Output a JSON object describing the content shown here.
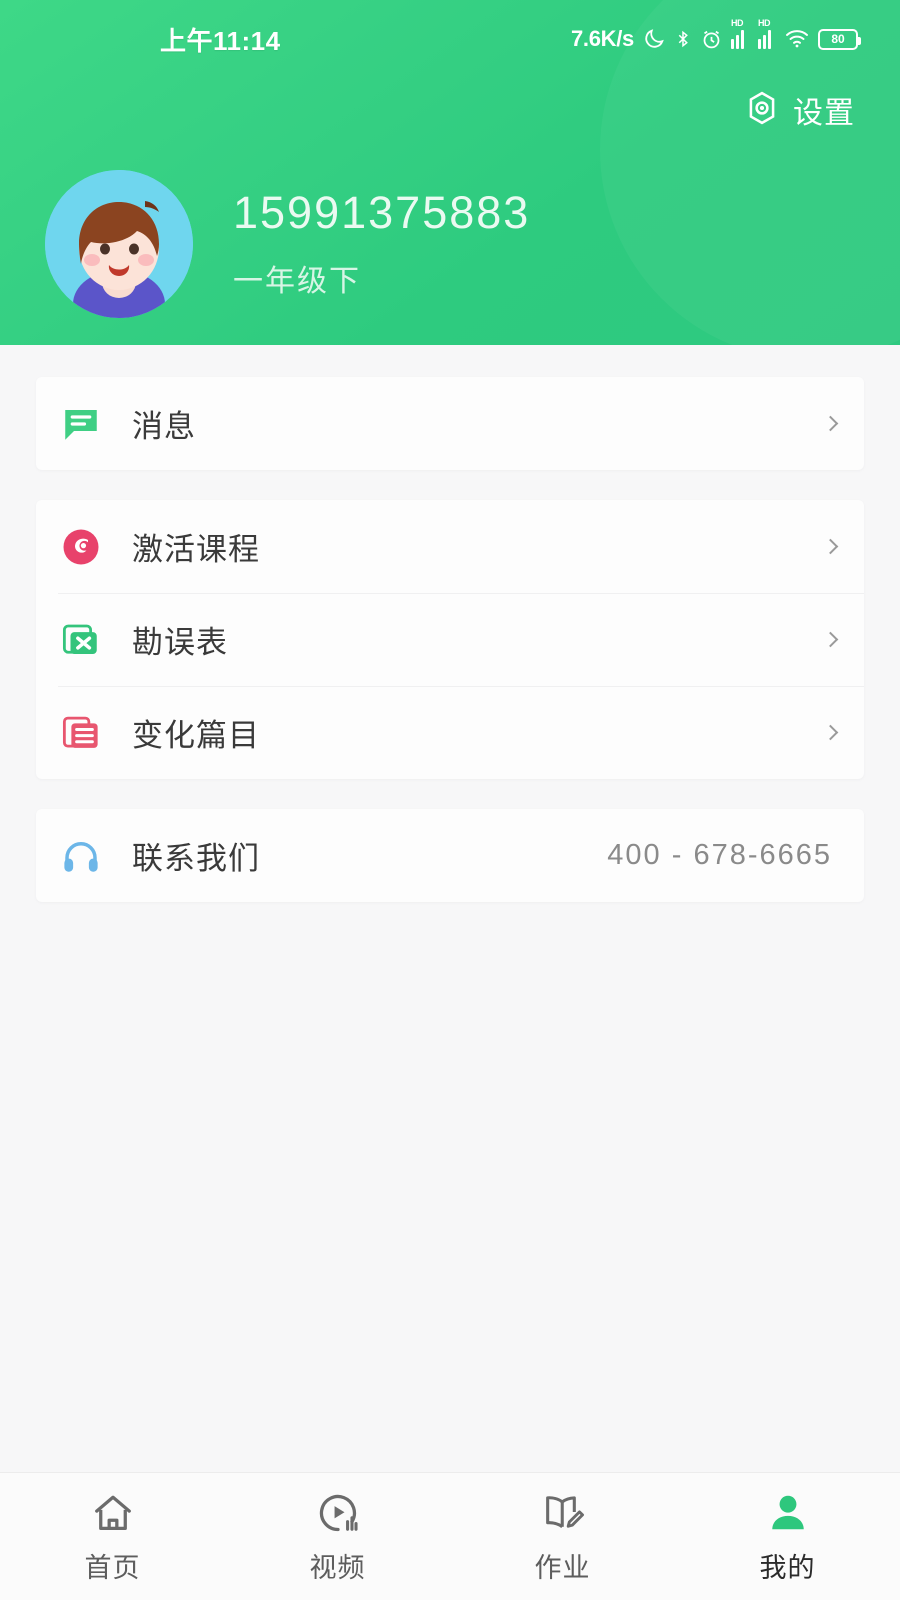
{
  "status_bar": {
    "time": "上午11:14",
    "network_speed": "7.6K/s",
    "battery_level": "80",
    "icons": [
      "moon-icon",
      "bluetooth-icon",
      "alarm-icon",
      "signal-hd-icon",
      "signal-hd-icon",
      "wifi-icon",
      "battery-icon"
    ],
    "signal_label": "HD"
  },
  "header": {
    "settings_label": "设置",
    "user_phone": "15991375883",
    "user_grade": "一年级下",
    "bg_color": "#35d285",
    "avatar_bg": "#6fd6ee"
  },
  "sections": [
    {
      "rows": [
        {
          "icon": "message-icon",
          "icon_color": "#3fcf84",
          "label": "消息",
          "value": "",
          "chevron": true
        }
      ]
    },
    {
      "rows": [
        {
          "icon": "activate-course-icon",
          "icon_color": "#e8426b",
          "label": "激活课程",
          "value": "",
          "chevron": true
        },
        {
          "icon": "errata-sheet-icon",
          "icon_color": "#34c47c",
          "label": "勘误表",
          "value": "",
          "chevron": true
        },
        {
          "icon": "changed-articles-icon",
          "icon_color": "#e8566f",
          "label": "变化篇目",
          "value": "",
          "chevron": true
        }
      ]
    },
    {
      "rows": [
        {
          "icon": "headphones-icon",
          "icon_color": "#6cb6e8",
          "label": "联系我们",
          "value": "400 - 678-6665",
          "chevron": false
        }
      ]
    }
  ],
  "tabbar": {
    "items": [
      {
        "icon": "home-icon",
        "label": "首页",
        "active": false
      },
      {
        "icon": "video-icon",
        "label": "视频",
        "active": false
      },
      {
        "icon": "homework-icon",
        "label": "作业",
        "active": false
      },
      {
        "icon": "profile-icon",
        "label": "我的",
        "active": true
      }
    ],
    "active_color": "#2ec77d",
    "inactive_color": "#5d5d5d"
  }
}
